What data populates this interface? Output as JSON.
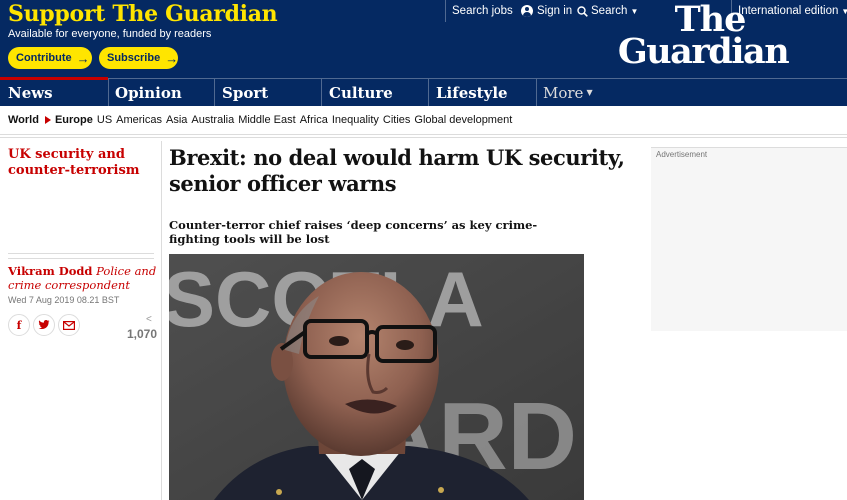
{
  "support": {
    "title": "Support The Guardian",
    "subtitle": "Available for everyone, funded by readers",
    "contribute_label": "Contribute",
    "subscribe_label": "Subscribe",
    "arrow": "→"
  },
  "topnav": {
    "search_jobs": "Search jobs",
    "sign_in": "Sign in",
    "search": "Search",
    "edition": "International edition",
    "chevron": "⌄"
  },
  "logo": {
    "line1": "The",
    "line2": "Guardian"
  },
  "pillars": [
    "News",
    "Opinion",
    "Sport",
    "Culture",
    "Lifestyle"
  ],
  "pillar_more": "More",
  "subnav": {
    "world": "World",
    "europe": "Europe",
    "items": [
      "US",
      "Americas",
      "Asia",
      "Australia",
      "Middle East",
      "Africa",
      "Inequality",
      "Cities",
      "Global development"
    ]
  },
  "article": {
    "section": "UK security and counter-terrorism",
    "author": "Vikram Dodd",
    "role": "Police and crime correspondent",
    "date": "Wed 7 Aug 2019 08.21 BST",
    "share_count": "1,070",
    "headline": "Brexit: no deal would harm UK security, senior officer warns",
    "standfirst": "Counter-terror chief raises ‘deep concerns’ as key crime-fighting tools will be lost",
    "photo_backdrop_text": "SCOTLAND YARD"
  },
  "share_icons": [
    "facebook-icon",
    "twitter-icon",
    "email-icon",
    "share-icon"
  ],
  "advert": {
    "label": "Advertisement"
  },
  "colors": {
    "brand_blue": "#052962",
    "brand_yellow": "#ffe500",
    "news_red": "#c70000"
  }
}
